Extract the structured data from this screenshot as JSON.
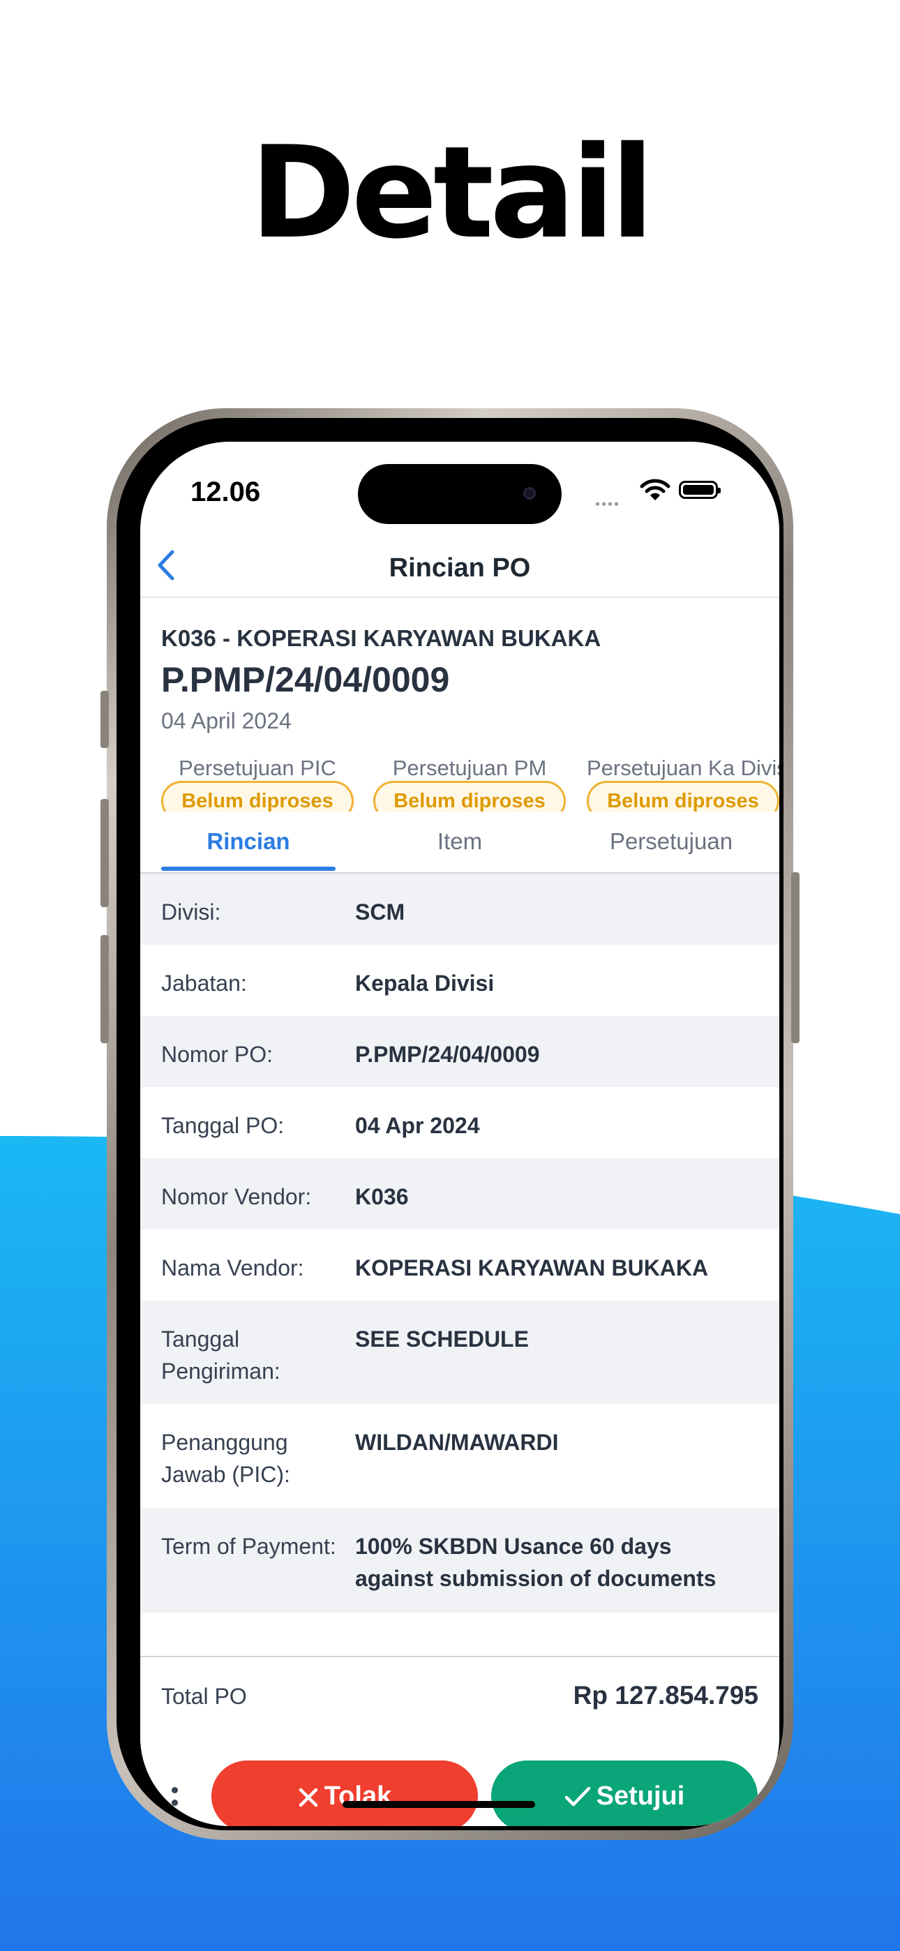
{
  "headline": "Detail",
  "colors": {
    "accent": "#2b7de2",
    "reject": "#f03e2f",
    "approve": "#0aa578",
    "pending": "#df9a00",
    "background_gradient": [
      "#1bb8f4",
      "#2175ea"
    ]
  },
  "status_bar": {
    "time": "12.06",
    "icons": [
      "signal-icon",
      "wifi-icon",
      "battery-icon"
    ]
  },
  "nav": {
    "title": "Rincian PO",
    "back_icon": "chevron-left-icon"
  },
  "po": {
    "vendor_line": "K036 - KOPERASI KARYAWAN BUKAKA",
    "number": "P.PMP/24/04/0009",
    "date": "04 April 2024"
  },
  "approvals": [
    {
      "label": "Persetujuan PIC",
      "status": "Belum diproses"
    },
    {
      "label": "Persetujuan PM",
      "status": "Belum diproses"
    },
    {
      "label": "Persetujuan Ka Divisi",
      "status": "Belum diproses"
    }
  ],
  "tabs": [
    {
      "label": "Rincian",
      "active": true
    },
    {
      "label": "Item",
      "active": false
    },
    {
      "label": "Persetujuan",
      "active": false
    }
  ],
  "details": [
    {
      "label": "Divisi:",
      "value": "SCM"
    },
    {
      "label": "Jabatan:",
      "value": "Kepala Divisi"
    },
    {
      "label": "Nomor PO:",
      "value": "P.PMP/24/04/0009"
    },
    {
      "label": "Tanggal PO:",
      "value": "04 Apr 2024"
    },
    {
      "label": "Nomor Vendor:",
      "value": "K036"
    },
    {
      "label": "Nama Vendor:",
      "value": "KOPERASI KARYAWAN BUKAKA"
    },
    {
      "label": "Tanggal Pengiriman:",
      "value": "SEE SCHEDULE"
    },
    {
      "label": "Penanggung Jawab (PIC):",
      "value": "WILDAN/MAWARDI"
    },
    {
      "label": "Term of Payment:",
      "value": "100% SKBDN Usance 60 days against submission of documents"
    }
  ],
  "total": {
    "label": "Total PO",
    "value": "Rp 127.854.795"
  },
  "actions": {
    "reject_label": "Tolak",
    "approve_label": "Setujui",
    "more_icon": "more-vertical-icon"
  }
}
